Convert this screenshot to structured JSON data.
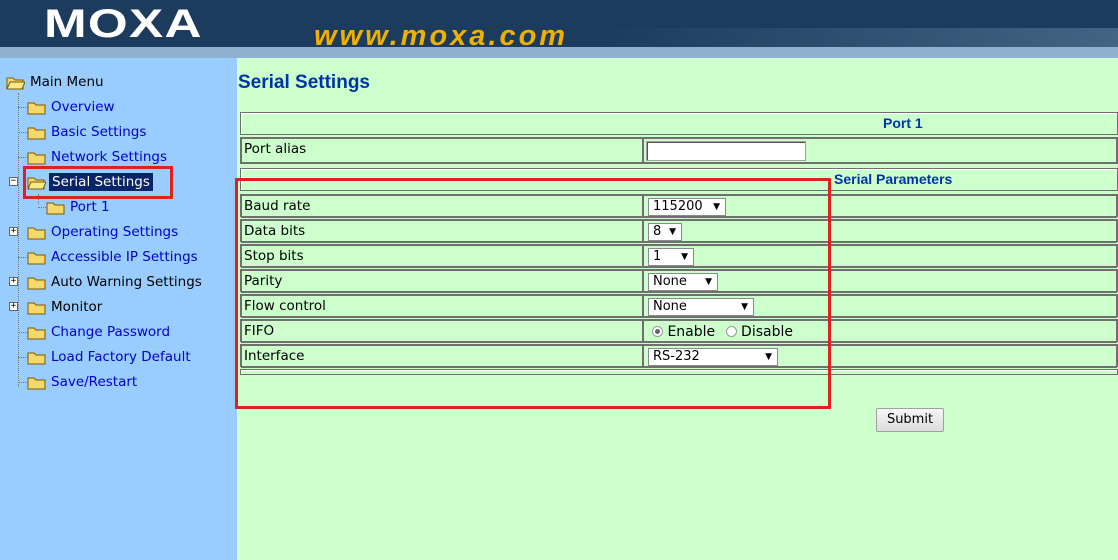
{
  "header": {
    "logo": "MOXA",
    "url": "www.moxa.com"
  },
  "sidebar": {
    "items": [
      {
        "label": "Main Menu"
      },
      {
        "label": "Overview"
      },
      {
        "label": "Basic Settings"
      },
      {
        "label": "Network Settings"
      },
      {
        "label": "Serial Settings"
      },
      {
        "label": "Port 1"
      },
      {
        "label": "Operating Settings"
      },
      {
        "label": "Accessible IP Settings"
      },
      {
        "label": "Auto Warning Settings"
      },
      {
        "label": "Monitor"
      },
      {
        "label": "Change Password"
      },
      {
        "label": "Load Factory Default"
      },
      {
        "label": "Save/Restart"
      }
    ]
  },
  "main": {
    "title": "Serial Settings",
    "port_header": "Port 1",
    "port_alias": {
      "label": "Port alias",
      "value": ""
    },
    "params_header": "Serial Parameters",
    "params": [
      {
        "label": "Baud rate",
        "value": "115200"
      },
      {
        "label": "Data bits",
        "value": "8"
      },
      {
        "label": "Stop bits",
        "value": "1"
      },
      {
        "label": "Parity",
        "value": "None"
      },
      {
        "label": "Flow control",
        "value": "None"
      }
    ],
    "fifo": {
      "label": "FIFO",
      "enable": "Enable",
      "disable": "Disable",
      "selected": "Enable"
    },
    "interface": {
      "label": "Interface",
      "value": "RS-232"
    },
    "submit": "Submit"
  },
  "colors": {
    "header_bg": "#1d3b5c",
    "url": "#f0b000",
    "sidebar_bg": "#99ccff",
    "content_bg": "#ccffcc",
    "title": "#0033aa",
    "link": "#0000cc",
    "highlight_box": "#e02020"
  },
  "icons": [
    "folder-icon",
    "open-folder-icon",
    "expand-plus-icon",
    "collapse-minus-icon",
    "dropdown-arrow-icon"
  ]
}
